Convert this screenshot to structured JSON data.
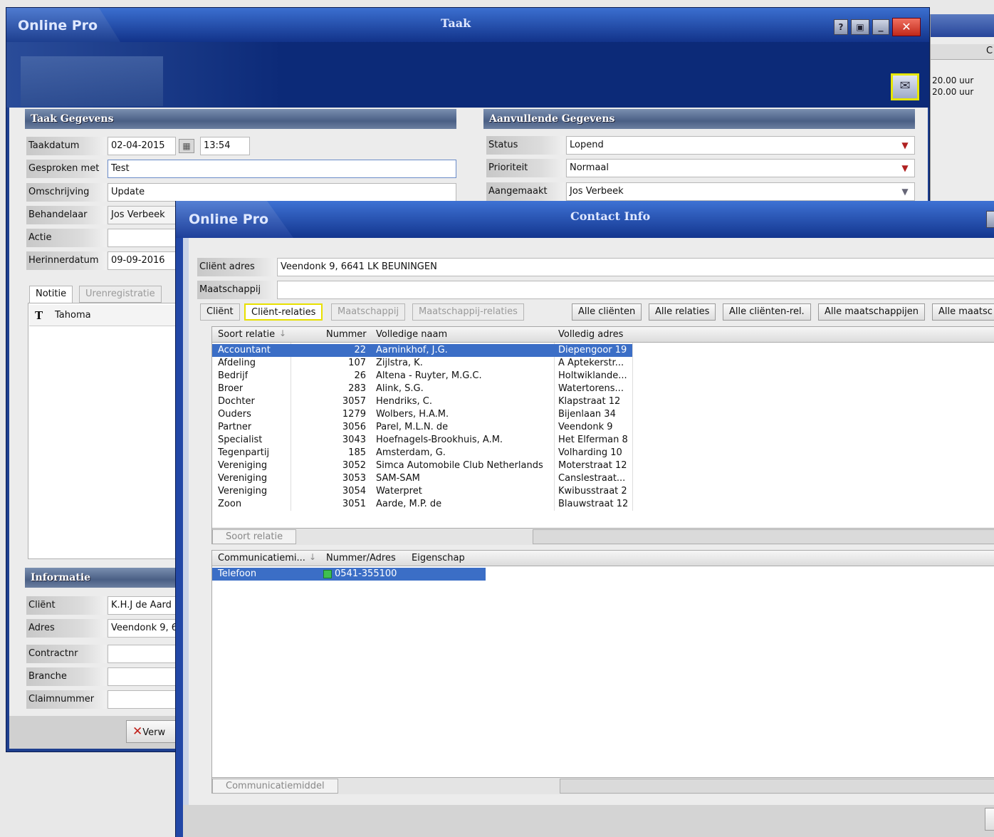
{
  "back_window": {
    "app_name": "Online Pro",
    "title": "Taak",
    "controls": [
      "?",
      "▣",
      "_",
      "✕"
    ],
    "left_section_title": "Taak Gegevens",
    "right_section_title": "Aanvullende Gegevens",
    "fields": {
      "taakdatum_label": "Taakdatum",
      "taakdatum_value": "02-04-2015",
      "taaktijd_value": "13:54",
      "gesproken_label": "Gesproken met",
      "gesproken_value": "Test",
      "omschrijving_label": "Omschrijving",
      "omschrijving_value": "Update",
      "behandelaar_label": "Behandelaar",
      "behandelaar_value": "Jos Verbeek",
      "actie_label": "Actie",
      "actie_value": "",
      "herinnerdatum_label": "Herinnerdatum",
      "herinnerdatum_value": "09-09-2016"
    },
    "right_fields": {
      "status_label": "Status",
      "status_value": "Lopend",
      "prioriteit_label": "Prioriteit",
      "prioriteit_value": "Normaal",
      "aangemaakt_label": "Aangemaakt",
      "aangemaakt_value": "Jos Verbeek"
    },
    "tabs": [
      "Notitie",
      "Urenregistratie"
    ],
    "font_name": "Tahoma",
    "info_section_title": "Informatie",
    "info_fields": {
      "client_label": "Cliënt",
      "client_value": "K.H.J de Aard",
      "adres_label": "Adres",
      "adres_value": "Veendonk 9, 6",
      "contractnr_label": "Contractnr",
      "branche_label": "Branche",
      "claimnummer_label": "Claimnummer"
    },
    "cancel_button": "Verw",
    "side_times": [
      "20.00 uur",
      "20.00 uur"
    ],
    "side_col_letter": "C"
  },
  "contact_window": {
    "app_name": "Online Pro",
    "title": "Contact Info",
    "client_adres_label": "Cliënt adres",
    "client_adres_value": "Veendonk 9, 6641 LK  BEUNINGEN",
    "maatschappij_label": "Maatschappij",
    "maatschappij_value": "",
    "tabs": [
      {
        "label": "Cliënt",
        "disabled": false
      },
      {
        "label": "Cliënt-relaties",
        "disabled": false,
        "active": true
      },
      {
        "label": "Maatschappij",
        "disabled": true
      },
      {
        "label": "Maatschappij-relaties",
        "disabled": true
      }
    ],
    "filter_buttons": [
      "Alle cliënten",
      "Alle relaties",
      "Alle cliënten-rel.",
      "Alle maatschappijen",
      "Alle maatsc"
    ],
    "relations_headers": [
      "Soort relatie",
      "Nummer",
      "Volledige naam",
      "Volledig adres"
    ],
    "relations": [
      {
        "soort": "Accountant",
        "nummer": "22",
        "naam": "Aarninkhof, J.G.",
        "adres": "Diepengoor 19"
      },
      {
        "soort": "Afdeling",
        "nummer": "107",
        "naam": "Zijlstra, K.",
        "adres": "A Aptekerstr..."
      },
      {
        "soort": "Bedrijf",
        "nummer": "26",
        "naam": "Altena - Ruyter, M.G.C.",
        "adres": "Holtwiklande..."
      },
      {
        "soort": "Broer",
        "nummer": "283",
        "naam": "Alink, S.G.",
        "adres": "Watertorens..."
      },
      {
        "soort": "Dochter",
        "nummer": "3057",
        "naam": "Hendriks, C.",
        "adres": "Klapstraat 12"
      },
      {
        "soort": "Ouders",
        "nummer": "1279",
        "naam": "Wolbers, H.A.M.",
        "adres": "Bijenlaan 34"
      },
      {
        "soort": "Partner",
        "nummer": "3056",
        "naam": "Parel, M.L.N. de",
        "adres": "Veendonk 9"
      },
      {
        "soort": "Specialist",
        "nummer": "3043",
        "naam": "Hoefnagels-Brookhuis, A.M.",
        "adres": "Het Elferman 8"
      },
      {
        "soort": "Tegenpartij",
        "nummer": "185",
        "naam": "Amsterdam, G.",
        "adres": "Volharding 10"
      },
      {
        "soort": "Vereniging",
        "nummer": "3052",
        "naam": "Simca Automobile Club Netherlands",
        "adres": "Moterstraat 12"
      },
      {
        "soort": "Vereniging",
        "nummer": "3053",
        "naam": "SAM-SAM",
        "adres": "Canslestraat..."
      },
      {
        "soort": "Vereniging",
        "nummer": "3054",
        "naam": "Waterpret",
        "adres": "Kwibusstraat 2"
      },
      {
        "soort": "Zoon",
        "nummer": "3051",
        "naam": "Aarde, M.P. de",
        "adres": "Blauwstraat 12"
      }
    ],
    "group_label_1": "Soort relatie",
    "comm_headers": [
      "Communicatiemi...",
      "Nummer/Adres",
      "Eigenschap"
    ],
    "comm_rows": [
      {
        "type": "Telefoon",
        "nummer": "0541-355100",
        "eigenschap": ""
      }
    ],
    "group_label_2": "Communicatiemiddel"
  }
}
